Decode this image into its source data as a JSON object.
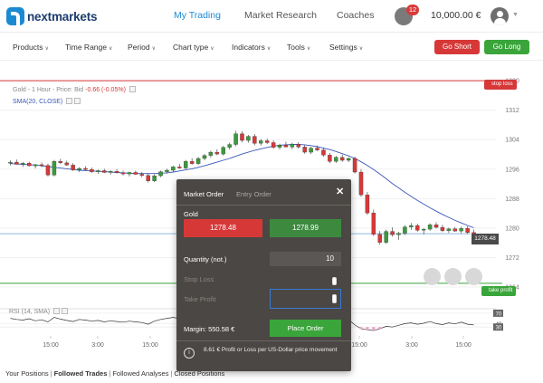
{
  "header": {
    "logo_text": "nextmarkets",
    "nav": [
      {
        "label": "My Trading",
        "active": true
      },
      {
        "label": "Market Research",
        "active": false
      },
      {
        "label": "Coaches",
        "active": false
      }
    ],
    "notification_count": "12",
    "balance": "10,000.00 €"
  },
  "toolbar": {
    "items": [
      "Products",
      "Time Range",
      "Period",
      "Chart type",
      "Indicators",
      "Tools",
      "Settings"
    ],
    "go_short": "Go Short",
    "go_long": "Go Long"
  },
  "chart": {
    "instrument_line": "Gold - 1 Hour - Price: Bid",
    "change": "-0.66 (-0.05%)",
    "sma_label": "SMA(20, CLOSE)",
    "rsi_label": "RSI (14, SMA)",
    "stop_loss_tag": "stop loss",
    "take_profit_tag": "take profit",
    "current_price_tag": "1278.48",
    "colors": {
      "up": "#d63838",
      "down": "#3a9a3a",
      "sma": "#3a57b8",
      "stop_loss": "#d63838",
      "take_profit": "#3aa53a",
      "current_price": "#8fb8e0"
    }
  },
  "chart_data": {
    "type": "candlestick",
    "y_ticks": [
      "1320",
      "1312",
      "1304",
      "1296",
      "1288",
      "1280",
      "1272",
      "1264"
    ],
    "x_ticks": [
      "15:00",
      "3:00",
      "15:00",
      "3:00",
      "15:00",
      "3:00",
      "15:00",
      "3:00",
      "15:00"
    ],
    "rsi_ticks": [
      "70",
      "40",
      "30"
    ],
    "ylim": [
      1264,
      1322
    ],
    "stop_loss": 1320,
    "take_profit": 1265,
    "current_price": 1278.48,
    "candles": [
      [
        1297.6,
        1298.4,
        1297.0,
        1297.9
      ],
      [
        1297.9,
        1298.6,
        1297.2,
        1297.3
      ],
      [
        1297.3,
        1297.9,
        1296.6,
        1297.6
      ],
      [
        1297.6,
        1298.0,
        1296.8,
        1296.9
      ],
      [
        1296.9,
        1297.4,
        1296.2,
        1297.2
      ],
      [
        1297.2,
        1297.8,
        1296.5,
        1297.0
      ],
      [
        1297.0,
        1297.5,
        1294.0,
        1294.4
      ],
      [
        1294.4,
        1298.5,
        1294.0,
        1298.1
      ],
      [
        1298.1,
        1298.8,
        1297.4,
        1297.7
      ],
      [
        1297.7,
        1298.3,
        1296.9,
        1297.1
      ],
      [
        1297.1,
        1297.6,
        1295.5,
        1295.8
      ],
      [
        1295.8,
        1296.5,
        1295.2,
        1296.2
      ],
      [
        1296.2,
        1296.8,
        1295.6,
        1295.9
      ],
      [
        1295.9,
        1296.4,
        1295.0,
        1295.3
      ],
      [
        1295.3,
        1295.9,
        1294.7,
        1295.6
      ],
      [
        1295.6,
        1296.1,
        1294.9,
        1295.1
      ],
      [
        1295.1,
        1295.7,
        1294.5,
        1295.4
      ],
      [
        1295.4,
        1296.0,
        1294.8,
        1295.0
      ],
      [
        1295.0,
        1295.6,
        1294.3,
        1294.7
      ],
      [
        1294.7,
        1295.3,
        1294.0,
        1295.1
      ],
      [
        1295.1,
        1295.6,
        1294.4,
        1294.6
      ],
      [
        1294.6,
        1295.2,
        1293.8,
        1294.3
      ],
      [
        1294.3,
        1294.9,
        1292.4,
        1292.8
      ],
      [
        1292.8,
        1294.6,
        1292.5,
        1294.2
      ],
      [
        1294.2,
        1295.6,
        1293.8,
        1295.3
      ],
      [
        1295.3,
        1296.1,
        1294.8,
        1295.7
      ],
      [
        1295.7,
        1296.9,
        1295.2,
        1296.6
      ],
      [
        1296.6,
        1297.4,
        1296.1,
        1296.3
      ],
      [
        1296.3,
        1298.5,
        1296.0,
        1298.1
      ],
      [
        1298.1,
        1299.0,
        1297.2,
        1297.5
      ],
      [
        1297.5,
        1299.3,
        1297.1,
        1298.9
      ],
      [
        1298.9,
        1300.1,
        1298.4,
        1299.7
      ],
      [
        1299.7,
        1301.0,
        1299.1,
        1300.6
      ],
      [
        1300.6,
        1301.4,
        1299.8,
        1300.1
      ],
      [
        1300.1,
        1302.3,
        1299.7,
        1301.9
      ],
      [
        1301.9,
        1303.2,
        1301.3,
        1302.7
      ],
      [
        1302.7,
        1306.4,
        1302.2,
        1305.6
      ],
      [
        1305.6,
        1306.3,
        1303.3,
        1303.8
      ],
      [
        1303.8,
        1305.3,
        1303.2,
        1304.9
      ],
      [
        1304.9,
        1305.5,
        1302.5,
        1303.0
      ],
      [
        1303.0,
        1304.2,
        1302.4,
        1303.7
      ],
      [
        1303.7,
        1304.3,
        1302.8,
        1303.2
      ],
      [
        1303.2,
        1303.8,
        1301.5,
        1301.9
      ],
      [
        1301.9,
        1302.9,
        1301.3,
        1302.5
      ],
      [
        1302.5,
        1303.4,
        1301.9,
        1302.0
      ],
      [
        1302.0,
        1303.2,
        1301.4,
        1302.8
      ],
      [
        1302.8,
        1303.3,
        1301.6,
        1302.0
      ],
      [
        1302.0,
        1302.5,
        1300.2,
        1300.6
      ],
      [
        1300.6,
        1302.1,
        1300.1,
        1301.7
      ],
      [
        1301.7,
        1302.4,
        1300.9,
        1301.2
      ],
      [
        1301.2,
        1301.8,
        1299.4,
        1299.8
      ],
      [
        1299.8,
        1300.4,
        1297.6,
        1298.1
      ],
      [
        1298.1,
        1299.6,
        1297.7,
        1299.2
      ],
      [
        1299.2,
        1299.9,
        1298.0,
        1298.4
      ],
      [
        1298.4,
        1299.2,
        1297.9,
        1298.9
      ],
      [
        1298.9,
        1299.4,
        1294.8,
        1295.2
      ],
      [
        1295.2,
        1296.0,
        1288.5,
        1289.0
      ],
      [
        1289.0,
        1289.8,
        1283.6,
        1284.1
      ],
      [
        1284.1,
        1285.0,
        1277.8,
        1278.3
      ],
      [
        1278.3,
        1279.2,
        1275.5,
        1276.1
      ],
      [
        1276.1,
        1279.6,
        1275.7,
        1279.1
      ],
      [
        1279.1,
        1280.2,
        1277.7,
        1278.2
      ],
      [
        1278.2,
        1279.0,
        1276.8,
        1278.6
      ],
      [
        1278.6,
        1280.8,
        1278.1,
        1280.3
      ],
      [
        1280.3,
        1281.4,
        1279.5,
        1280.7
      ],
      [
        1280.7,
        1281.2,
        1279.0,
        1279.4
      ],
      [
        1279.4,
        1280.0,
        1278.3,
        1279.7
      ],
      [
        1279.7,
        1281.3,
        1279.3,
        1280.9
      ],
      [
        1280.9,
        1281.6,
        1279.9,
        1280.2
      ],
      [
        1280.2,
        1280.9,
        1278.9,
        1279.3
      ],
      [
        1279.3,
        1280.1,
        1278.7,
        1279.8
      ],
      [
        1279.8,
        1280.3,
        1279.0,
        1279.2
      ],
      [
        1279.2,
        1280.4,
        1278.6,
        1279.9
      ],
      [
        1279.9,
        1280.5,
        1278.4,
        1278.8
      ],
      [
        1278.8,
        1279.6,
        1277.9,
        1278.48
      ]
    ],
    "sma": [
      1297.5,
      1297.4,
      1297.3,
      1297.2,
      1297.1,
      1296.9,
      1296.7,
      1296.5,
      1296.3,
      1296.1,
      1295.9,
      1295.7,
      1295.6,
      1295.5,
      1295.4,
      1295.3,
      1295.2,
      1295.1,
      1295.0,
      1294.9,
      1294.8,
      1294.8,
      1294.8,
      1294.8,
      1294.9,
      1295.0,
      1295.2,
      1295.5,
      1295.8,
      1296.1,
      1296.5,
      1296.9,
      1297.4,
      1297.9,
      1298.4,
      1298.9,
      1299.5,
      1300.1,
      1300.6,
      1301.1,
      1301.5,
      1301.9,
      1302.2,
      1302.5,
      1302.6,
      1302.7,
      1302.7,
      1302.6,
      1302.4,
      1302.1,
      1301.7,
      1301.3,
      1300.8,
      1300.2,
      1299.6,
      1298.9,
      1298.0,
      1297.0,
      1295.9,
      1294.7,
      1293.4,
      1292.1,
      1290.9,
      1289.7,
      1288.6,
      1287.5,
      1286.5,
      1285.5,
      1284.6,
      1283.7,
      1282.9,
      1282.1,
      1281.4,
      1280.7,
      1280.1
    ],
    "rsi": [
      55,
      52,
      50,
      54,
      48,
      51,
      45,
      58,
      53,
      49,
      46,
      52,
      50,
      47,
      49,
      45,
      48,
      46,
      44,
      47,
      45,
      43,
      38,
      47,
      52,
      55,
      58,
      54,
      62,
      57,
      60,
      64,
      66,
      61,
      65,
      68,
      72,
      60,
      63,
      55,
      60,
      57,
      50,
      56,
      54,
      58,
      52,
      46,
      55,
      50,
      43,
      38,
      50,
      45,
      52,
      36,
      25,
      22,
      20,
      25,
      32,
      30,
      35,
      40,
      42,
      38,
      41,
      46,
      40,
      37,
      42,
      39,
      44,
      38,
      36
    ]
  },
  "order_panel": {
    "tab_market": "Market Order",
    "tab_entry": "Entry Order",
    "close": "✕",
    "instrument": "Gold",
    "sell_price": "1278.48",
    "buy_price": "1278.99",
    "quantity_label": "Quantity (not.)",
    "quantity_value": "10",
    "stop_loss_label": "Stop Loss",
    "take_profit_label": "Take Profit",
    "margin_label": "Margin: 550.58 €",
    "place_order": "Place Order",
    "info_icon": "i",
    "info_text": "8.61 € Profit or Loss per US-Dollar price movement"
  },
  "footer": {
    "tabs": [
      {
        "label": "Your Positions",
        "selected": false
      },
      {
        "label": "Followed Trades",
        "selected": true
      },
      {
        "label": "Followed Analyses",
        "selected": false
      },
      {
        "label": "Closed Positions",
        "selected": false
      }
    ]
  }
}
